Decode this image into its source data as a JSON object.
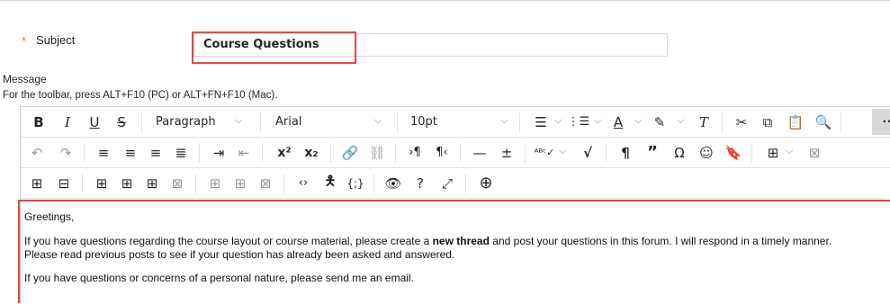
{
  "subject": {
    "required_mark": "*",
    "label": "Subject",
    "value": "Course Questions"
  },
  "message": {
    "label": "Message",
    "toolbar_hint": "For the toolbar, press ALT+F10 (PC) or ALT+FN+F10 (Mac)."
  },
  "toolbar": {
    "paragraph": "Paragraph",
    "font": "Arial",
    "size": "10pt",
    "more": "··"
  },
  "content": {
    "greeting": "Greetings,",
    "p1_before": "If you have questions regarding the course layout or course material, please create a ",
    "p1_bold": "new thread",
    "p1_after": " and post your questions in this forum. I will respond in a timely manner.",
    "p2": "Please read previous posts to see if your question has already been asked and answered.",
    "p3": "If you have questions or concerns of a personal nature, please send me an email."
  },
  "colors": {
    "highlight": "#e64a3b",
    "required": "#e07b32"
  }
}
